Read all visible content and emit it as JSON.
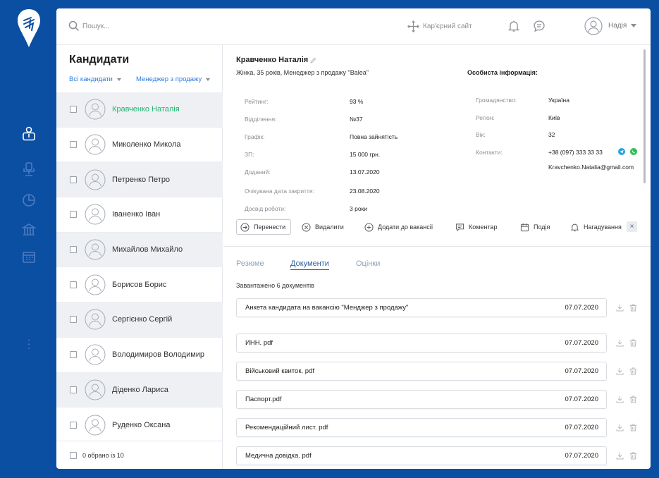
{
  "search": {
    "placeholder": "Пошук..."
  },
  "header": {
    "career_site": "Кар'єрний сайт",
    "user_name": "Надія"
  },
  "candidates": {
    "title": "Кандидати",
    "filters": [
      "Всі кандидати",
      "Менеджер з продажу"
    ],
    "items": [
      "Кравченко Наталія",
      "Миколенко Микола",
      "Петренко Петро",
      "Іваненко Іван",
      "Михайлов Михайло",
      "Борисов Борис",
      "Сергієнко Сергій",
      "Володимиров Володимир",
      "Діденко Лариса",
      "Руденко Оксана"
    ],
    "selected_text": "0 обрано із 10"
  },
  "detail": {
    "name": "Кравченко Наталія",
    "subtitle": "Жінка, 35 років, Менеджер з продажу \"Balea\"",
    "fields": [
      {
        "label": "Рейтинг:",
        "value": "93 %"
      },
      {
        "label": "Відділення:",
        "value": "№37"
      },
      {
        "label": "Графік:",
        "value": "Повна зайнятість"
      },
      {
        "label": "ЗП:",
        "value": "15 000 грн."
      },
      {
        "label": "Доданий:",
        "value": "13.07.2020"
      },
      {
        "label": "Очікувана дата закриття:",
        "value": "23.08.2020"
      },
      {
        "label": "Досвід роботи:",
        "value": "3 роки"
      }
    ],
    "personal": {
      "title": "Особиста інформація:",
      "fields": [
        {
          "label": "Громадянство:",
          "value": "Україна"
        },
        {
          "label": "Регіон:",
          "value": "Київ"
        },
        {
          "label": "Вік:",
          "value": "32"
        },
        {
          "label": "Контакти:",
          "value": "+38 (097) 333 33 33"
        }
      ],
      "email": "Kravchenko.Natalia@gmail.com"
    },
    "actions": {
      "move": "Перенести",
      "delete": "Видалити",
      "add_to_vacancy": "Додати до вакансії",
      "comment": "Коментар",
      "event": "Подія",
      "reminder": "Нагадування",
      "close": "×"
    },
    "tabs": [
      "Резюме",
      "Документи",
      "Оцінки"
    ],
    "docs_count": "Завантажено 6 документів",
    "documents": [
      {
        "name": "Анкета кандидата на вакансію \"Менджер з продажу\"",
        "date": "07.07.2020"
      },
      {
        "name": "ИНН. pdf",
        "date": "07.07.2020"
      },
      {
        "name": "Військовий квиток. pdf",
        "date": "07.07.2020"
      },
      {
        "name": "Паспорт.pdf",
        "date": "07.07.2020"
      },
      {
        "name": "Рекомендаційний лист. pdf",
        "date": "07.07.2020"
      },
      {
        "name": "Медична довідка. pdf",
        "date": "07.07.2020"
      }
    ]
  },
  "colors": {
    "background": "#0b4fa3",
    "accent": "#2a7de1",
    "active_candidate": "#22b573",
    "tab_active": "#2b5f9e"
  }
}
